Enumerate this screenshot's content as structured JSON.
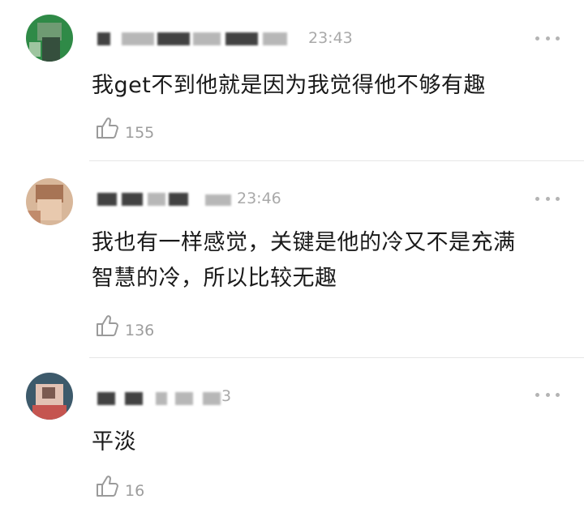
{
  "comments": [
    {
      "time": "23:43",
      "text": "我get不到他就是因为我觉得他不够有趣",
      "likes": "155",
      "avatar_colors": [
        "#2c7a3e",
        "#6b9c6e",
        "#2f5a34",
        "#8cb08d"
      ]
    },
    {
      "time": "23:46",
      "text_line1": "我也有一样感觉，关键是他的冷又不是充满",
      "text_line2": "智慧的冷，所以比较无趣",
      "likes": "136",
      "avatar_colors": [
        "#c7a184",
        "#d8b79a",
        "#a07257",
        "#e8cdb7"
      ]
    },
    {
      "time": "3",
      "text": "平淡",
      "likes": "16",
      "avatar_colors": [
        "#3d5a6b",
        "#c65a55",
        "#8a6e64",
        "#e4c3b6"
      ]
    }
  ],
  "icons": {
    "like": "thumbs-up-icon",
    "more": "more-dots-icon"
  }
}
